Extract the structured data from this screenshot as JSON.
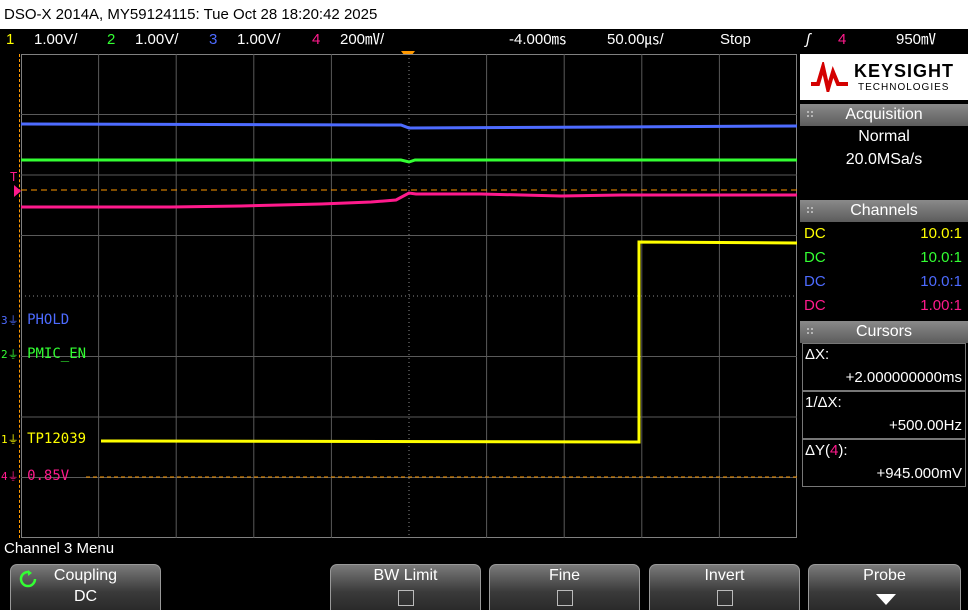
{
  "title": "DSO-X 2014A, MY59124115: Tue Oct 28 18:20:42 2025",
  "status": {
    "ch1_num": "1",
    "ch1_scale": "1.00V/",
    "ch2_num": "2",
    "ch2_scale": "1.00V/",
    "ch3_num": "3",
    "ch3_scale": "1.00V/",
    "ch4_num": "4",
    "ch4_scale": "200㎷/",
    "delay": "-4.000㎳",
    "timebase": "50.00㎲/",
    "run_state": "Stop",
    "trigger_slope": "ʃ",
    "trigger_source": "4",
    "trigger_level": "950㎷"
  },
  "colors": {
    "ch1": "#ffff00",
    "ch2": "#33ff33",
    "ch3": "#4d6bff",
    "ch4": "#ff1a8c",
    "trigger": "#ff9900",
    "grid": "#606060",
    "bg": "#000000"
  },
  "waveform_labels": {
    "ch3": {
      "num": "3",
      "name": "PHOLD"
    },
    "ch2": {
      "num": "2",
      "name": "PMIC_EN"
    },
    "ch1": {
      "num": "1",
      "name": "TP12039"
    },
    "ch4": {
      "num": "4",
      "name": "0.85V"
    },
    "trigger_marker": "T"
  },
  "panel": {
    "logo_line1": "KEYSIGHT",
    "logo_line2": "TECHNOLOGIES",
    "acquisition_head": "Acquisition",
    "acq_mode": "Normal",
    "acq_rate": "20.0MSa/s",
    "channels_head": "Channels",
    "channels": [
      {
        "coupling": "DC",
        "probe": "10.0:1"
      },
      {
        "coupling": "DC",
        "probe": "10.0:1"
      },
      {
        "coupling": "DC",
        "probe": "10.0:1"
      },
      {
        "coupling": "DC",
        "probe": "1.00:1"
      }
    ],
    "cursors_head": "Cursors",
    "dx_label": "ΔX:",
    "dx_value": "+2.000000000ms",
    "inv_dx_label": "1/ΔX:",
    "inv_dx_value": "+500.00Hz",
    "dy_label_pre": "ΔY(",
    "dy_label_ch": "4",
    "dy_label_post": "):",
    "dy_value": "+945.000mV"
  },
  "menu_title": "Channel 3 Menu",
  "softkeys": {
    "coupling_label": "Coupling",
    "coupling_value": "DC",
    "bw_limit": "BW Limit",
    "fine": "Fine",
    "invert": "Invert",
    "probe": "Probe"
  }
}
